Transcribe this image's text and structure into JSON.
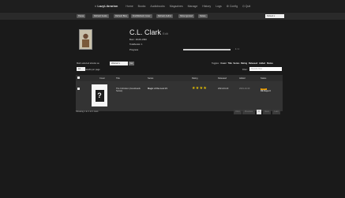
{
  "nav": {
    "brand": "LazyLibrarian",
    "items": [
      "Home",
      "Books",
      "Audiobooks",
      "Magazines",
      "Manage",
      "History",
      "Logs",
      "Config",
      "Quit"
    ]
  },
  "toolbar": {
    "buttons": [
      "Pause",
      "Refresh books",
      "Refresh Bios",
      "Find/Refresh Cover",
      "Refresh Author",
      "Show Ignored",
      "Delete"
    ],
    "select_value": "Default"
  },
  "author": {
    "name": "C.L. Clark",
    "edit_label": "Edit",
    "born": "Born: 18-06-1990",
    "totalbooks": "Totalbooks: 1",
    "progress_label": "Progress",
    "progress_text": "1 / 1",
    "progress": 1.0
  },
  "controls": {
    "with_selected": "Mark selected ebooks as",
    "action_value": "Wanted",
    "go_label": "Go",
    "page_size": "10",
    "per_page": "results per page",
    "toggles_label": "Toggles:",
    "toggles": [
      "Cover",
      "Title",
      "Series",
      "Rating",
      "Released",
      "Added",
      "Status"
    ],
    "filter_label": "Filter:",
    "filter_placeholder": "Results filter"
  },
  "table": {
    "headers": [
      "",
      "Cover",
      "Title",
      "Series",
      "Rating",
      "Released",
      "Added",
      "Status"
    ],
    "rows": [
      {
        "cover_glyph": "?",
        "title": "The Unbroken (Goodreads Series)",
        "series": "Magic of the Lost #1",
        "rating": "★★★★",
        "released": "2021-03-23",
        "added": "2023-10-30",
        "status_badge": "Open",
        "status_link": "RE Report"
      }
    ]
  },
  "footer": {
    "showing": "Showing 1 to 1 of 1 rows",
    "pager": [
      "First",
      "Previous",
      "1",
      "Next",
      "Last"
    ]
  },
  "colors": {
    "accent": "#f0a30a",
    "star": "#e8c200"
  }
}
